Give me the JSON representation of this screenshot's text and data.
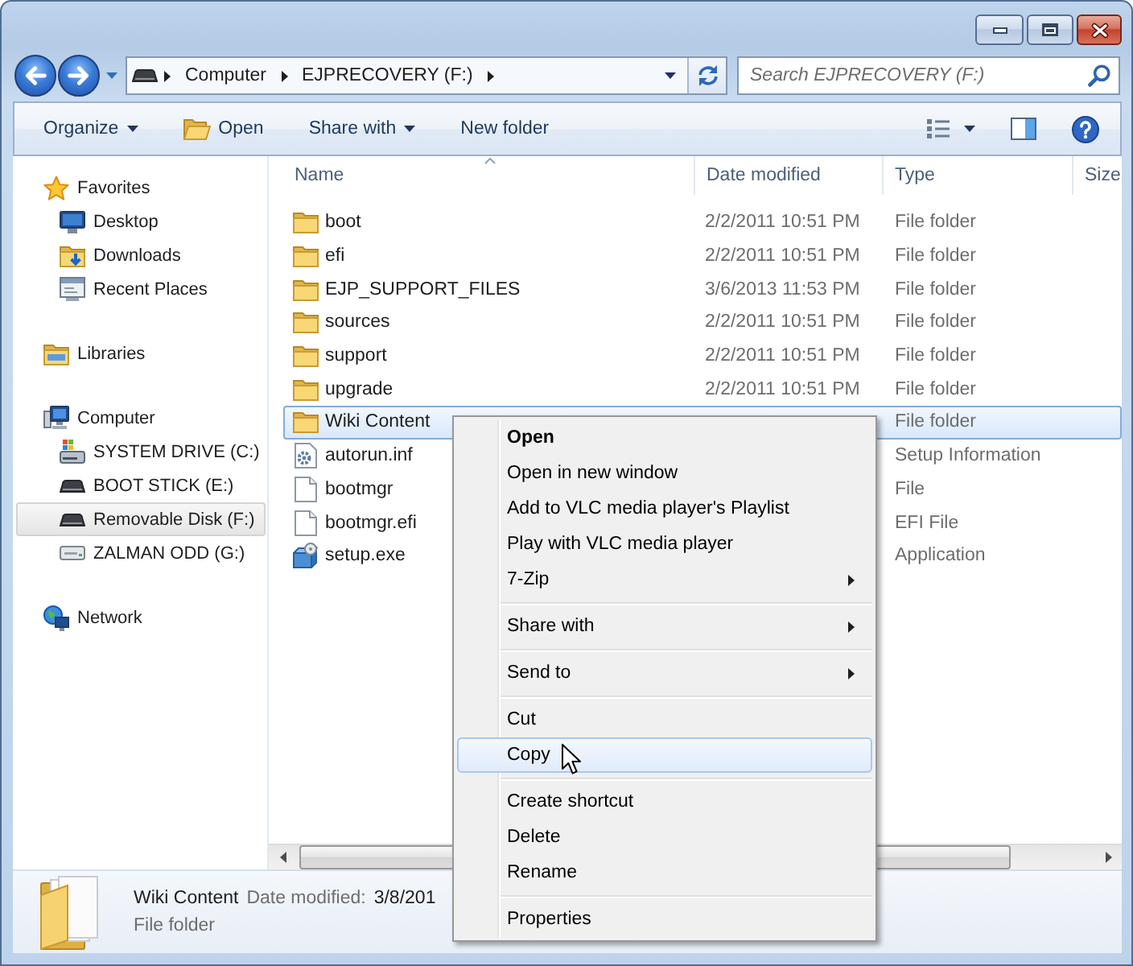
{
  "address_bar": {
    "breadcrumbs": [
      "Computer",
      "EJPRECOVERY (F:)"
    ]
  },
  "search": {
    "placeholder": "Search EJPRECOVERY (F:)"
  },
  "toolbar": {
    "buttons": [
      {
        "label": "Organize",
        "kind": "dropdown"
      },
      {
        "label": "Open",
        "kind": "icon"
      },
      {
        "label": "Share with",
        "kind": "dropdown"
      },
      {
        "label": "New folder",
        "kind": "plain"
      }
    ]
  },
  "sidebar": {
    "items": [
      {
        "label": "Favorites",
        "kind": "favorites",
        "selected": false,
        "children": [
          {
            "label": "Desktop",
            "kind": "desktop",
            "selected": false
          },
          {
            "label": "Downloads",
            "kind": "downloads",
            "selected": false
          },
          {
            "label": "Recent Places",
            "kind": "recent",
            "selected": false
          }
        ]
      },
      {
        "label": "Libraries",
        "kind": "libraries",
        "selected": false
      },
      {
        "label": "Computer",
        "kind": "computer",
        "selected": false,
        "children": [
          {
            "label": "SYSTEM DRIVE (C:)",
            "kind": "system_drive",
            "selected": false
          },
          {
            "label": "BOOT STICK (E:)",
            "kind": "drive",
            "selected": false
          },
          {
            "label": "Removable Disk (F:)",
            "kind": "drive",
            "selected": true
          },
          {
            "label": "ZALMAN ODD (G:)",
            "kind": "optical_drive",
            "selected": false
          }
        ]
      },
      {
        "label": "Network",
        "kind": "network",
        "selected": false
      }
    ]
  },
  "files": {
    "columns": [
      {
        "label": "Name",
        "sorted": true
      },
      {
        "label": "Date modified",
        "sorted": false
      },
      {
        "label": "Type",
        "sorted": false
      },
      {
        "label": "Size",
        "sorted": false
      }
    ],
    "rows": [
      {
        "name": "boot",
        "date_modified": "2/2/2011 10:51 PM",
        "type": "File folder",
        "kind": "folder",
        "selected": false
      },
      {
        "name": "efi",
        "date_modified": "2/2/2011 10:51 PM",
        "type": "File folder",
        "kind": "folder",
        "selected": false
      },
      {
        "name": "EJP_SUPPORT_FILES",
        "date_modified": "3/6/2013 11:53 PM",
        "type": "File folder",
        "kind": "folder",
        "selected": false
      },
      {
        "name": "sources",
        "date_modified": "2/2/2011 10:51 PM",
        "type": "File folder",
        "kind": "folder",
        "selected": false
      },
      {
        "name": "support",
        "date_modified": "2/2/2011 10:51 PM",
        "type": "File folder",
        "kind": "folder",
        "selected": false
      },
      {
        "name": "upgrade",
        "date_modified": "2/2/2011 10:51 PM",
        "type": "File folder",
        "kind": "folder",
        "selected": false
      },
      {
        "name": "Wiki Content",
        "type": "File folder",
        "kind": "folder",
        "selected": true
      },
      {
        "name": "autorun.inf",
        "type": "Setup Information",
        "kind": "settings_file",
        "selected": false
      },
      {
        "name": "bootmgr",
        "type": "File",
        "kind": "file",
        "selected": false
      },
      {
        "name": "bootmgr.efi",
        "type": "EFI File",
        "kind": "file",
        "selected": false
      },
      {
        "name": "setup.exe",
        "type": "Application",
        "kind": "installer",
        "selected": false
      }
    ]
  },
  "details": {
    "name": "Wiki Content",
    "date_label": "Date modified:",
    "date_value": "3/8/201",
    "type": "File folder"
  },
  "context_menu": {
    "groups": [
      {
        "items": [
          {
            "label": "Open",
            "default": true,
            "submenu": false,
            "selected": false
          },
          {
            "label": "Open in new window",
            "default": false,
            "submenu": false,
            "selected": false
          },
          {
            "label": "Add to VLC media player's Playlist",
            "default": false,
            "submenu": false,
            "selected": false
          },
          {
            "label": "Play with VLC media player",
            "default": false,
            "submenu": false,
            "selected": false
          },
          {
            "label": "7-Zip",
            "default": false,
            "submenu": true,
            "selected": false
          }
        ]
      },
      {
        "items": [
          {
            "label": "Share with",
            "default": false,
            "submenu": true,
            "selected": false
          }
        ]
      },
      {
        "items": [
          {
            "label": "Send to",
            "default": false,
            "submenu": true,
            "selected": false
          }
        ]
      },
      {
        "items": [
          {
            "label": "Cut",
            "default": false,
            "submenu": false,
            "selected": false
          },
          {
            "label": "Copy",
            "default": false,
            "submenu": false,
            "selected": true
          }
        ]
      },
      {
        "items": [
          {
            "label": "Create shortcut",
            "default": false,
            "submenu": false,
            "selected": false
          },
          {
            "label": "Delete",
            "default": false,
            "submenu": false,
            "selected": false
          },
          {
            "label": "Rename",
            "default": false,
            "submenu": false,
            "selected": false
          }
        ]
      },
      {
        "items": [
          {
            "label": "Properties",
            "default": false,
            "submenu": false,
            "selected": false
          }
        ]
      }
    ]
  }
}
